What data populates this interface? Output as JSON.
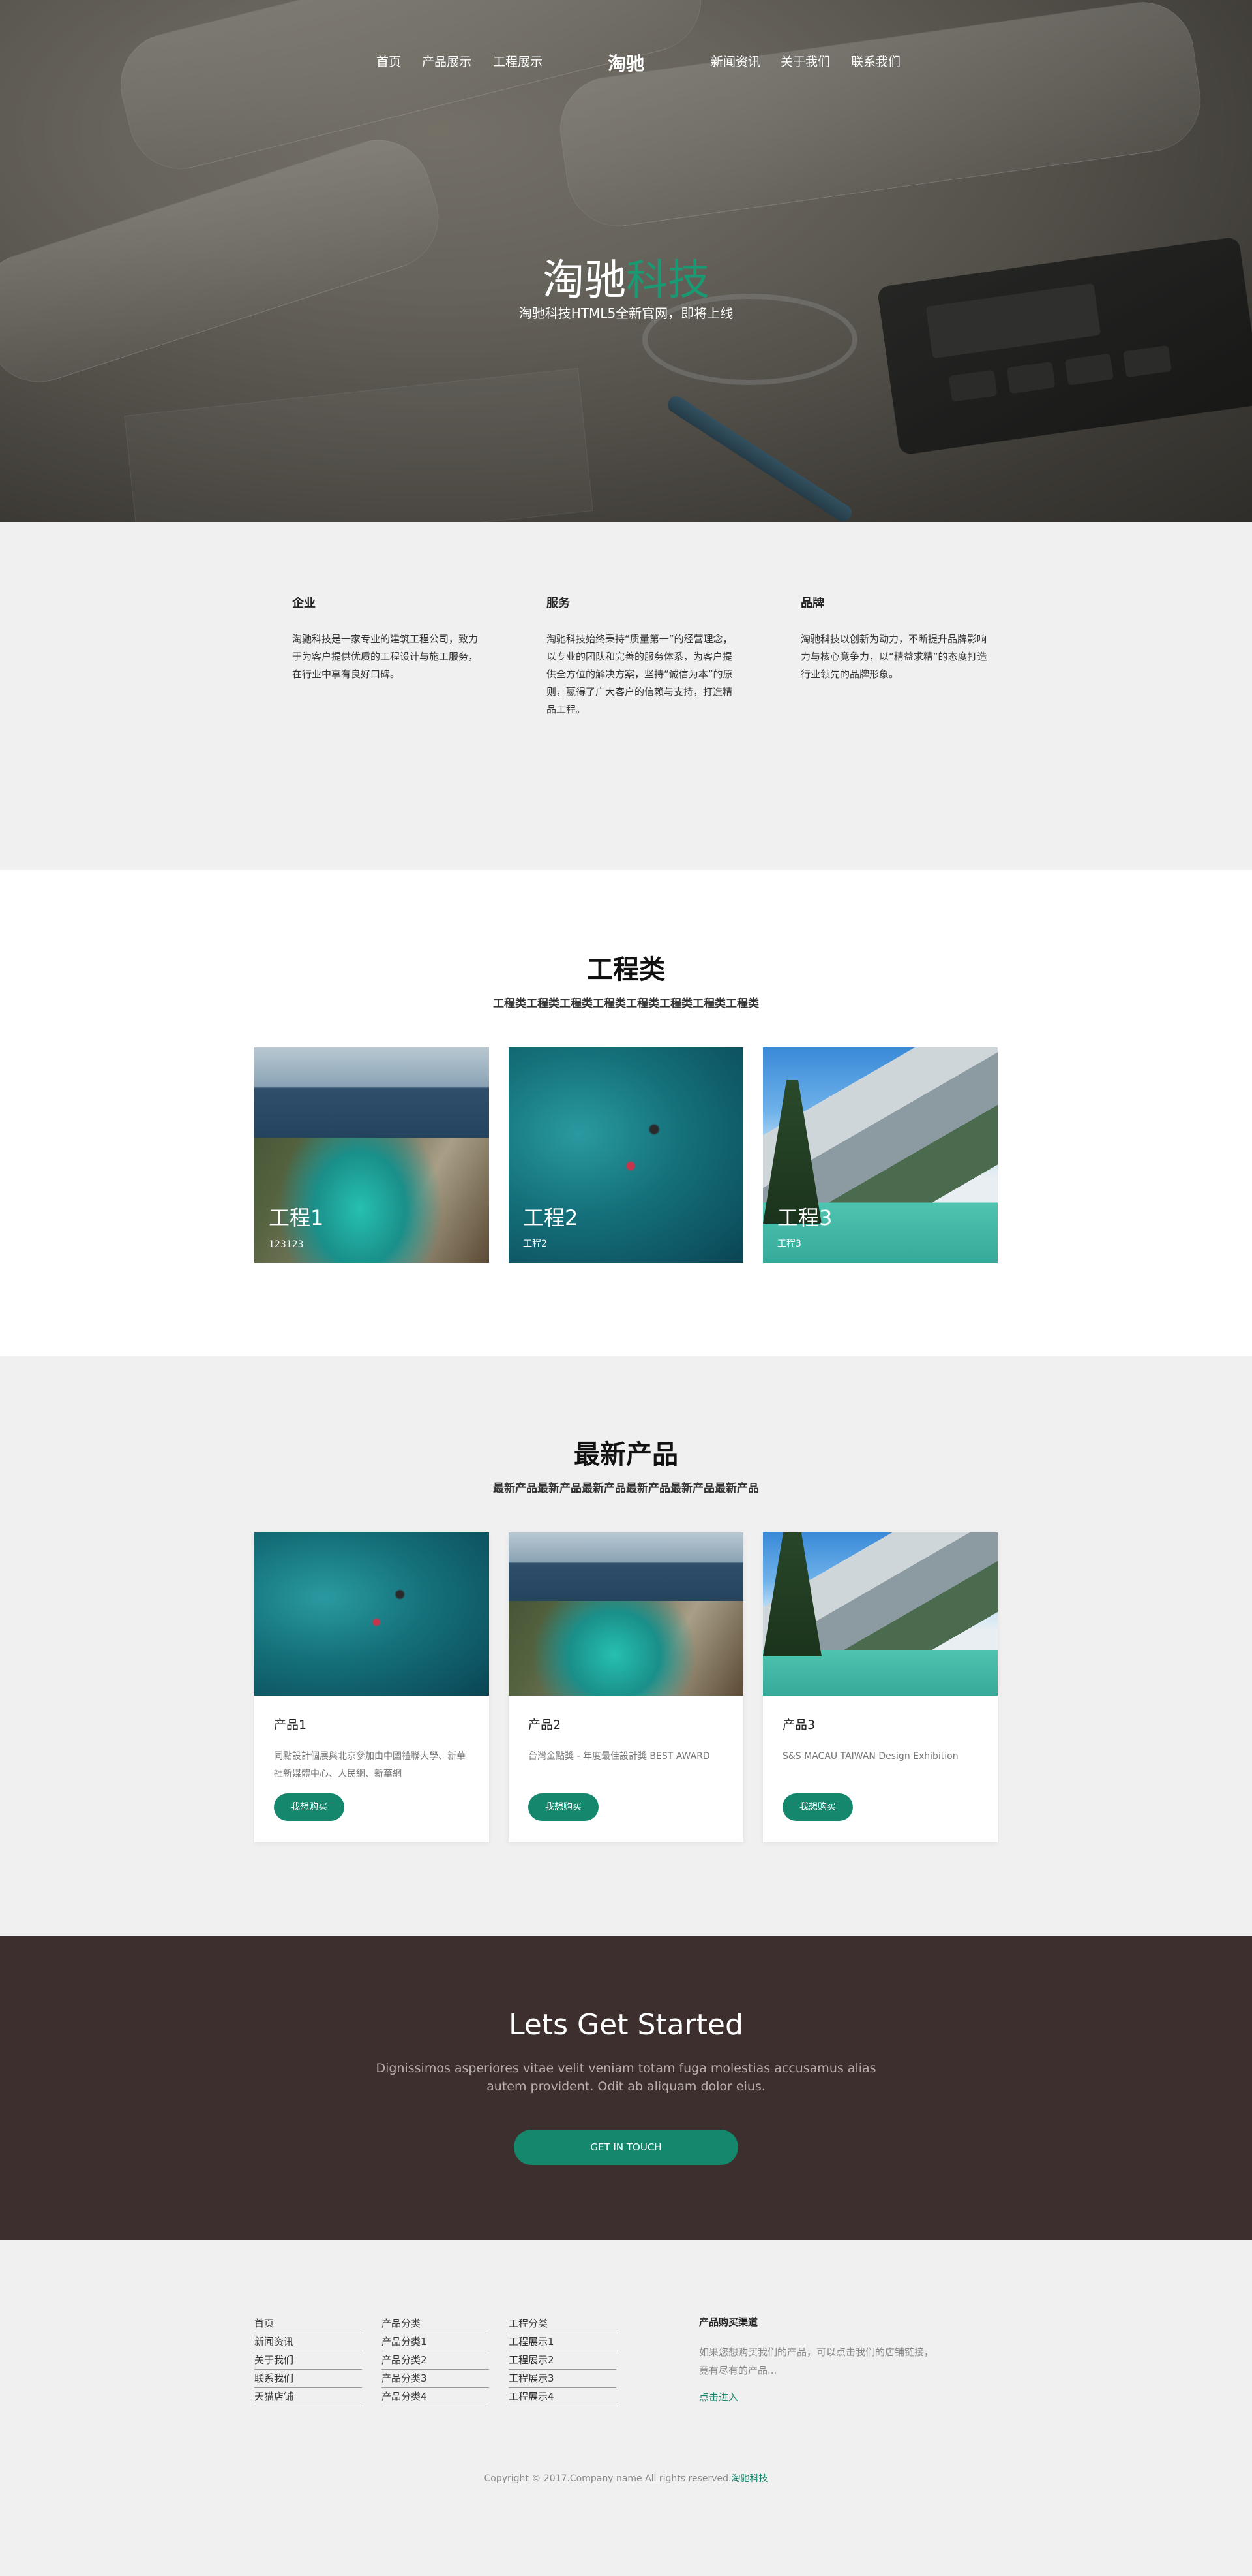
{
  "nav": {
    "left": [
      "首页",
      "产品展示",
      "工程展示"
    ],
    "logo": "淘驰",
    "right": [
      "新闻资讯",
      "关于我们",
      "联系我们"
    ]
  },
  "hero": {
    "title_main": "淘驰",
    "title_accent": "科技",
    "subtitle": "淘驰科技HTML5全新官网，即将上线"
  },
  "features": [
    {
      "title": "企业",
      "text": "淘驰科技是一家专业的建筑工程公司，致力于为客户提供优质的工程设计与施工服务，在行业中享有良好口碑。"
    },
    {
      "title": "服务",
      "text": "淘驰科技始终秉持“质量第一”的经营理念，以专业的团队和完善的服务体系，为客户提供全方位的解决方案，坚持“诚信为本”的原则，赢得了广大客户的信赖与支持，打造精品工程。"
    },
    {
      "title": "品牌",
      "text": "淘驰科技以创新为动力，不断提升品牌影响力与核心竞争力，以“精益求精”的态度打造行业领先的品牌形象。"
    }
  ],
  "projects": {
    "title": "工程类",
    "subtitle": "工程类工程类工程类工程类工程类工程类工程类工程类",
    "items": [
      {
        "label": "工程1",
        "sub": "123123"
      },
      {
        "label": "工程2",
        "sub": "工程2"
      },
      {
        "label": "工程3",
        "sub": "工程3"
      }
    ]
  },
  "products": {
    "title": "最新产品",
    "subtitle": "最新产品最新产品最新产品最新产品最新产品最新产品",
    "items": [
      {
        "name": "产品1",
        "desc": "同點設計個展與北京參加由中國禮聯大學、新華社新媒體中心、人民網、新華網",
        "button": "我想购买"
      },
      {
        "name": "产品2",
        "desc": "台灣金點獎 - 年度最佳設計獎 BEST AWARD",
        "button": "我想购买"
      },
      {
        "name": "产品3",
        "desc": "S&S MACAU TAIWAN Design Exhibition",
        "button": "我想购买"
      }
    ]
  },
  "cta": {
    "title": "Lets Get Started",
    "text": "Dignissimos asperiores vitae velit veniam totam fuga molestias accusamus alias autem provident. Odit ab aliquam dolor eius.",
    "button": "GET IN TOUCH"
  },
  "footer": {
    "col1": [
      "首页",
      "新闻资讯",
      "关于我们",
      "联系我们",
      "天猫店铺"
    ],
    "col2": [
      "产品分类",
      "产品分类1",
      "产品分类2",
      "产品分类3",
      "产品分类4"
    ],
    "col3": [
      "工程分类",
      "工程展示1",
      "工程展示2",
      "工程展示3",
      "工程展示4"
    ],
    "buy_title": "产品购买渠道",
    "buy_text": "如果您想购买我们的产品，可以点击我们的店铺链接，竟有尽有的产品...",
    "buy_link": "点击进入",
    "copyright": "Copyright © 2017.Company name All rights reserved.",
    "copyright_brand": "淘驰科技"
  },
  "colors": {
    "accent": "#14876c",
    "title_accent": "#1a9a72",
    "cta_bg": "#3c2f2d",
    "section_bg": "#f0f0f0"
  }
}
